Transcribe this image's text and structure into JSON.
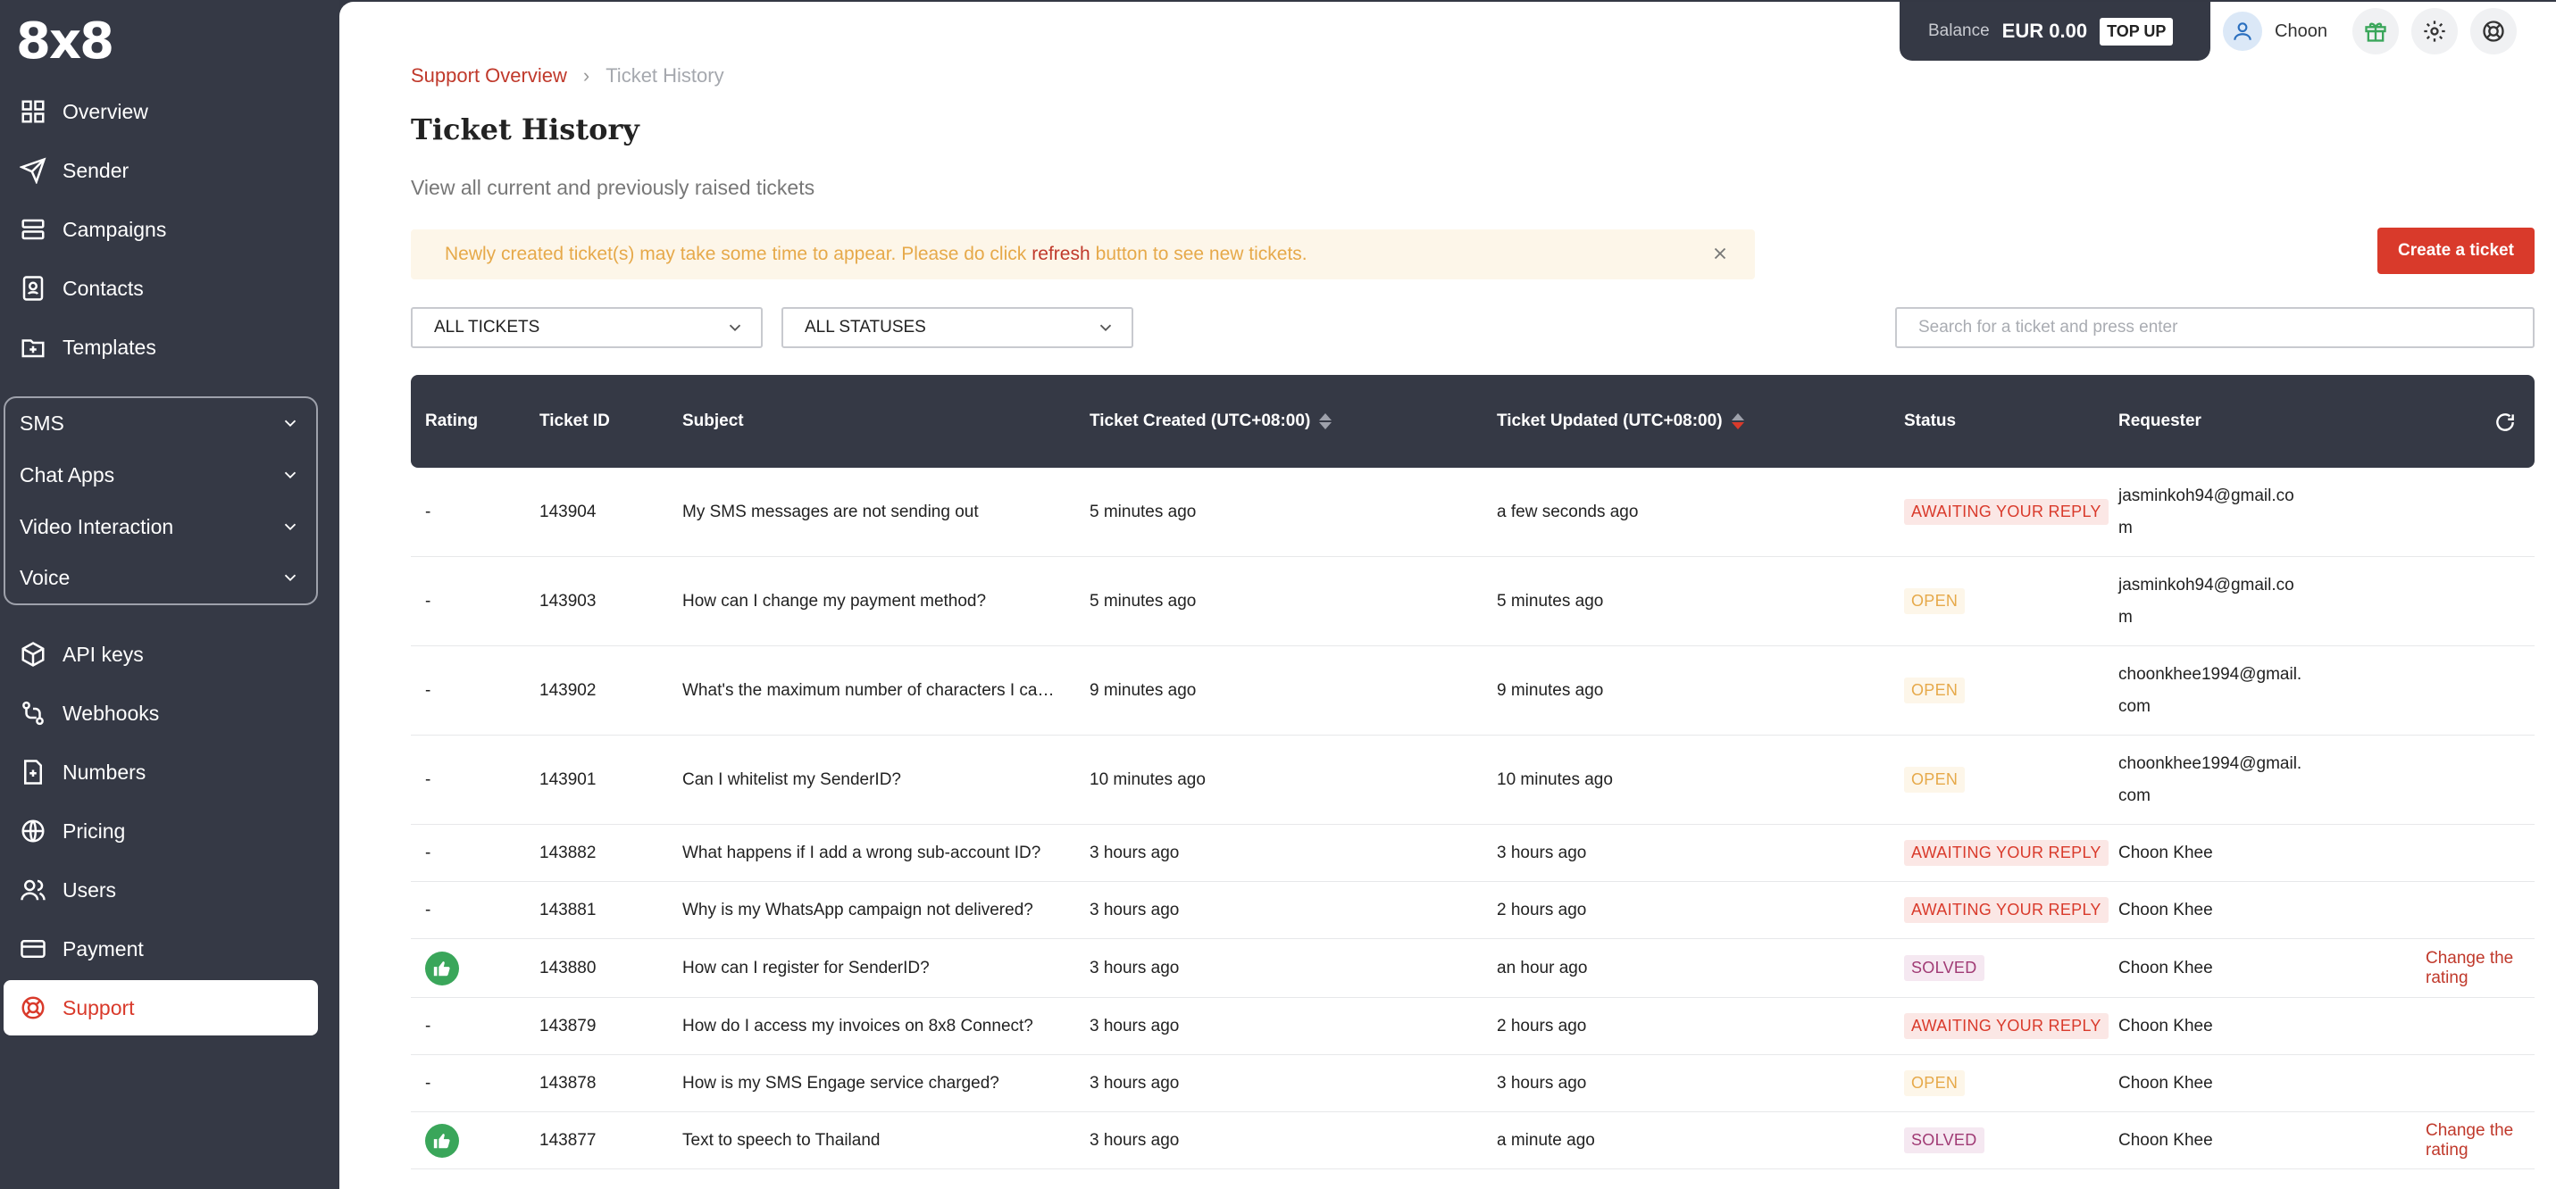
{
  "logo": "8x8",
  "sidebar": {
    "items_top": [
      {
        "label": "Overview",
        "icon": "grid-icon"
      },
      {
        "label": "Sender",
        "icon": "send-icon"
      },
      {
        "label": "Campaigns",
        "icon": "campaigns-icon"
      },
      {
        "label": "Contacts",
        "icon": "contacts-icon"
      },
      {
        "label": "Templates",
        "icon": "templates-icon"
      }
    ],
    "groups": [
      {
        "label": "SMS"
      },
      {
        "label": "Chat Apps"
      },
      {
        "label": "Video Interaction"
      },
      {
        "label": "Voice"
      }
    ],
    "items_bottom": [
      {
        "label": "API keys",
        "icon": "cube-icon"
      },
      {
        "label": "Webhooks",
        "icon": "webhooks-icon"
      },
      {
        "label": "Numbers",
        "icon": "numbers-icon"
      },
      {
        "label": "Pricing",
        "icon": "globe-icon"
      },
      {
        "label": "Users",
        "icon": "users-icon"
      },
      {
        "label": "Payment",
        "icon": "card-icon"
      },
      {
        "label": "Support",
        "icon": "lifebuoy-icon"
      }
    ]
  },
  "topbar": {
    "balance_label": "Balance",
    "balance_amount": "EUR 0.00",
    "topup_label": "TOP UP",
    "user_name": "Choon"
  },
  "breadcrumb": {
    "parent": "Support Overview",
    "current": "Ticket History"
  },
  "page": {
    "title": "Ticket History",
    "subtitle": "View all current and previously raised tickets"
  },
  "notice": {
    "before": "Newly created ticket(s) may take some time to appear. Please do click",
    "link": "refresh",
    "after": "button to see new tickets."
  },
  "create_button": "Create a ticket",
  "filters": {
    "tickets": "ALL TICKETS",
    "statuses": "ALL STATUSES",
    "search_placeholder": "Search for a ticket and press enter"
  },
  "table": {
    "headers": {
      "rating": "Rating",
      "id": "Ticket ID",
      "subject": "Subject",
      "created": "Ticket Created (UTC+08:00)",
      "updated": "Ticket Updated (UTC+08:00)",
      "status": "Status",
      "requester": "Requester"
    },
    "rows": [
      {
        "rating": "-",
        "id": "143904",
        "subject": "My SMS messages are not sending out",
        "created": "5 minutes ago",
        "updated": "a few seconds ago",
        "status": "AWAITING YOUR REPLY",
        "status_type": "awaiting",
        "requester": "jasminkoh94@gmail.com",
        "action": ""
      },
      {
        "rating": "-",
        "id": "143903",
        "subject": "How can I change my payment method?",
        "created": "5 minutes ago",
        "updated": "5 minutes ago",
        "status": "OPEN",
        "status_type": "open",
        "requester": "jasminkoh94@gmail.com",
        "action": ""
      },
      {
        "rating": "-",
        "id": "143902",
        "subject": "What's the maximum number of characters I can send in an SMS?",
        "created": "9 minutes ago",
        "updated": "9 minutes ago",
        "status": "OPEN",
        "status_type": "open",
        "requester": "choonkhee1994@gmail.com",
        "action": ""
      },
      {
        "rating": "-",
        "id": "143901",
        "subject": "Can I whitelist my SenderID?",
        "created": "10 minutes ago",
        "updated": "10 minutes ago",
        "status": "OPEN",
        "status_type": "open",
        "requester": "choonkhee1994@gmail.com",
        "action": ""
      },
      {
        "rating": "-",
        "id": "143882",
        "subject": "What happens if I add a wrong sub-account ID?",
        "created": "3 hours ago",
        "updated": "3 hours ago",
        "status": "AWAITING YOUR REPLY",
        "status_type": "awaiting",
        "requester": "Choon Khee",
        "action": ""
      },
      {
        "rating": "-",
        "id": "143881",
        "subject": "Why is my WhatsApp campaign not delivered?",
        "created": "3 hours ago",
        "updated": "2 hours ago",
        "status": "AWAITING YOUR REPLY",
        "status_type": "awaiting",
        "requester": "Choon Khee",
        "action": ""
      },
      {
        "rating": "thumbs-up",
        "id": "143880",
        "subject": "How can I register for SenderID?",
        "created": "3 hours ago",
        "updated": "an hour ago",
        "status": "SOLVED",
        "status_type": "solved",
        "requester": "Choon Khee",
        "action": "Change the rating"
      },
      {
        "rating": "-",
        "id": "143879",
        "subject": "How do I access my invoices on 8x8 Connect?",
        "created": "3 hours ago",
        "updated": "2 hours ago",
        "status": "AWAITING YOUR REPLY",
        "status_type": "awaiting",
        "requester": "Choon Khee",
        "action": ""
      },
      {
        "rating": "-",
        "id": "143878",
        "subject": "How is my SMS Engage service charged?",
        "created": "3 hours ago",
        "updated": "3 hours ago",
        "status": "OPEN",
        "status_type": "open",
        "requester": "Choon Khee",
        "action": ""
      },
      {
        "rating": "thumbs-up",
        "id": "143877",
        "subject": "Text to speech to Thailand",
        "created": "3 hours ago",
        "updated": "a minute ago",
        "status": "SOLVED",
        "status_type": "solved",
        "requester": "Choon Khee",
        "action": "Change the rating"
      }
    ]
  },
  "colors": {
    "sidebar_bg": "#353945",
    "accent_red": "#d93a2b",
    "open_yellow": "#e6a94a",
    "solved_purple": "#a03a74",
    "thumb_green": "#3aa65a"
  }
}
